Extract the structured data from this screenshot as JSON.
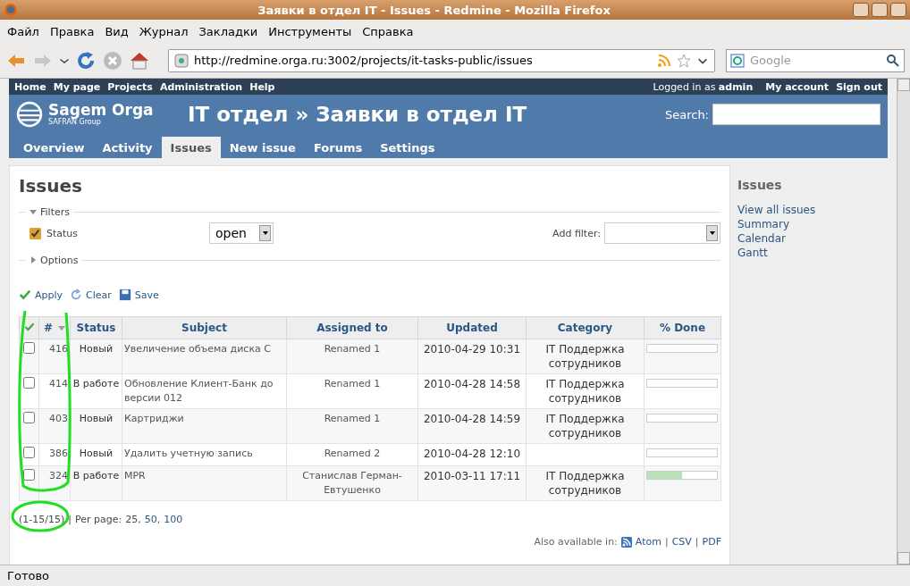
{
  "window": {
    "title": "Заявки в отдел IT - Issues - Redmine - Mozilla Firefox"
  },
  "menu": [
    "Файл",
    "Правка",
    "Вид",
    "Журнал",
    "Закладки",
    "Инструменты",
    "Справка"
  ],
  "toolbar": {
    "url": "http://redmine.orga.ru:3002/projects/it-tasks-public/issues",
    "search": {
      "placeholder": "Google"
    }
  },
  "top_menu": {
    "items": [
      "Home",
      "My page",
      "Projects",
      "Administration",
      "Help"
    ],
    "logged_in": "Logged in as",
    "user": "admin",
    "account": [
      "My account",
      "Sign out"
    ]
  },
  "header": {
    "logo": "Sagem Orga",
    "logo_sub": "SAFRAN Group",
    "title": "IT отдел » Заявки в отдел IT",
    "search_label": "Search:"
  },
  "tabs": [
    {
      "label": "Overview",
      "selected": false
    },
    {
      "label": "Activity",
      "selected": false
    },
    {
      "label": "Issues",
      "selected": true
    },
    {
      "label": "New issue",
      "selected": false
    },
    {
      "label": "Forums",
      "selected": false
    },
    {
      "label": "Settings",
      "selected": false
    }
  ],
  "content": {
    "heading": "Issues",
    "filters": {
      "legend": "Filters",
      "status": {
        "label": "Status",
        "checked": true,
        "value": "open"
      },
      "add_filter": "Add filter:"
    },
    "options": {
      "legend": "Options"
    },
    "actions": [
      "Apply",
      "Clear",
      "Save"
    ],
    "table": {
      "columns": [
        "#",
        "Status",
        "Subject",
        "Assigned to",
        "Updated",
        "Category",
        "% Done"
      ],
      "rows": [
        {
          "checked": false,
          "id": "416",
          "status": "Новый",
          "subject": "Увеличение объема диска С",
          "assignee": "Renamed 1",
          "updated": "2010-04-29 10:31",
          "category": "IT Поддержка сотрудников",
          "level": 0
        },
        {
          "checked": false,
          "id": "414",
          "status": "В работе",
          "subject": "Обновление Клиент-Банк до версии 012",
          "assignee": "Renamed 1",
          "updated": "2010-04-28 14:58",
          "category": "IT Поддержка сотрудников",
          "level": 0
        },
        {
          "checked": false,
          "id": "403",
          "status": "Новый",
          "subject": "Картриджи",
          "assignee": "Renamed 1",
          "updated": "2010-04-28 14:59",
          "category": "IT Поддержка сотрудников",
          "level": 0
        },
        {
          "checked": false,
          "id": "386",
          "status": "Новый",
          "subject": "Удалить учетную запись",
          "assignee": "Renamed 2",
          "updated": "2010-04-28 12:10",
          "category": "",
          "level": 0
        },
        {
          "checked": false,
          "id": "324",
          "status": "В работе",
          "subject": "MPR",
          "assignee": "Станислав Герман-Евтушенко",
          "updated": "2010-03-11 17:11",
          "category": "IT Поддержка сотрудников",
          "level": 0.5
        }
      ]
    },
    "pagination": {
      "range": "(1-15/15)",
      "separator": "|",
      "per_page": "Per page:",
      "options": [
        {
          "label": "25,",
          "selected": true
        },
        {
          "label": "50,",
          "selected": false
        },
        {
          "label": "100",
          "selected": false
        }
      ]
    },
    "other_formats": {
      "label": "Also available in:",
      "separator": "|",
      "formats": [
        "Atom",
        "CSV",
        "PDF"
      ]
    }
  },
  "sidebar": {
    "heading": "Issues",
    "links": [
      "View all issues",
      "Summary",
      "Calendar",
      "Gantt"
    ]
  },
  "status_bar": "Готово"
}
